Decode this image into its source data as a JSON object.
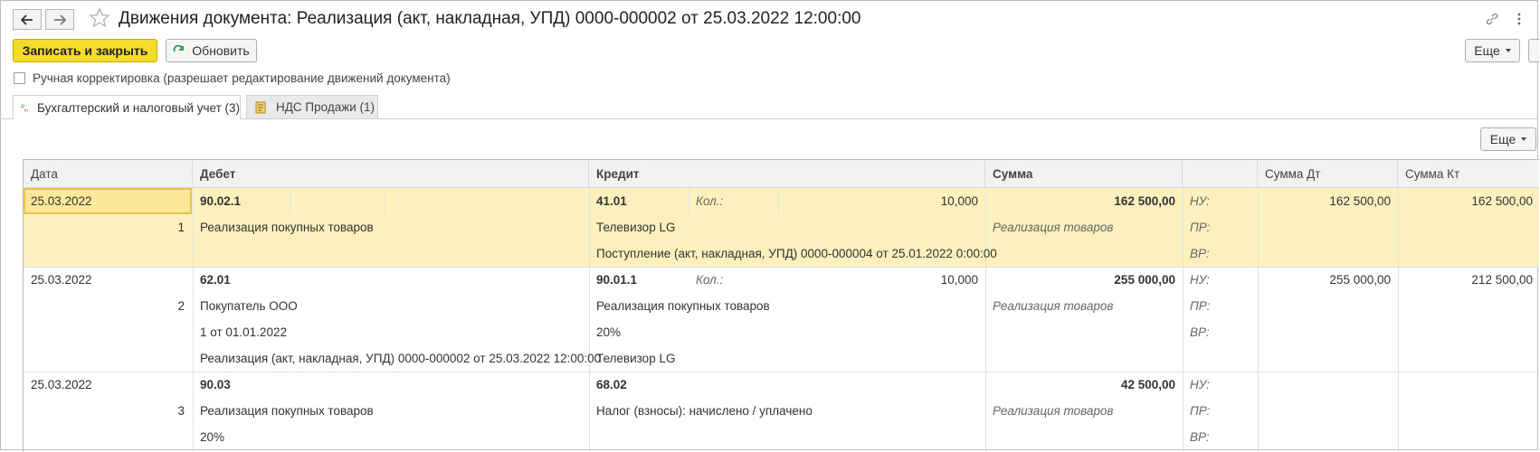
{
  "window": {
    "title": "Движения документа: Реализация (акт, накладная, УПД) 0000-000002 от 25.03.2022 12:00:00"
  },
  "icons": {
    "back": "arrow-left-icon",
    "forward": "arrow-right-icon",
    "favorite": "star-icon",
    "link": "link-icon",
    "more": "kebab-menu-icon",
    "refresh": "refresh-icon",
    "tab_accounting": "dt-kt-icon",
    "tab_vat": "document-icon"
  },
  "colors": {
    "primary_button": "#f5dc2a",
    "selected_row": "#fcf1be",
    "refresh_green": "#1c9a3a"
  },
  "toolbar": {
    "save_close_label": "Записать и закрыть",
    "refresh_label": "Обновить",
    "more_label": "Еще"
  },
  "manual_edit": {
    "label": "Ручная корректировка (разрешает редактирование движений документа)",
    "checked": false
  },
  "tabs": [
    {
      "label": "Бухгалтерский и налоговый учет (3)",
      "active": true
    },
    {
      "label": "НДС Продажи (1)",
      "active": false
    }
  ],
  "table_more_label": "Еще",
  "table": {
    "columns": [
      "Дата",
      "Дебет",
      "Кредит",
      "Сумма",
      "",
      "Сумма Дт",
      "Сумма Кт"
    ],
    "qty_label": "Кол.:",
    "rows": [
      {
        "date": "25.03.2022",
        "num": "1",
        "debit": "90.02.1",
        "debit_sub": [
          "Реализация покупных товаров",
          ""
        ],
        "credit": "41.01",
        "qty": "10,000",
        "credit_sub": [
          "Телевизор LG",
          "Поступление (акт, накладная, УПД) 0000-000004 от 25.01.2022 0:00:00"
        ],
        "sum": "162 500,00",
        "content": "Реализация товаров",
        "tax_labels": [
          "НУ:",
          "ПР:",
          "ВР:"
        ],
        "sum_dt": "162 500,00",
        "sum_kt": "162 500,00"
      },
      {
        "date": "25.03.2022",
        "num": "2",
        "debit": "62.01",
        "debit_sub": [
          "Покупатель ООО",
          "1 от 01.01.2022",
          "Реализация (акт, накладная, УПД) 0000-000002 от 25.03.2022 12:00:00"
        ],
        "credit": "90.01.1",
        "qty": "10,000",
        "credit_sub": [
          "Реализация покупных товаров",
          "20%",
          "Телевизор LG"
        ],
        "sum": "255 000,00",
        "content": "Реализация товаров",
        "tax_labels": [
          "НУ:",
          "ПР:",
          "ВР:"
        ],
        "sum_dt": "255 000,00",
        "sum_kt": "212 500,00"
      },
      {
        "date": "25.03.2022",
        "num": "3",
        "debit": "90.03",
        "debit_sub": [
          "Реализация покупных товаров",
          "20%"
        ],
        "credit": "68.02",
        "credit_sub": [
          "Налог (взносы): начислено / уплачено"
        ],
        "sum": "42 500,00",
        "content": "Реализация товаров",
        "tax_labels": [
          "НУ:",
          "ПР:",
          "ВР:"
        ]
      }
    ]
  }
}
